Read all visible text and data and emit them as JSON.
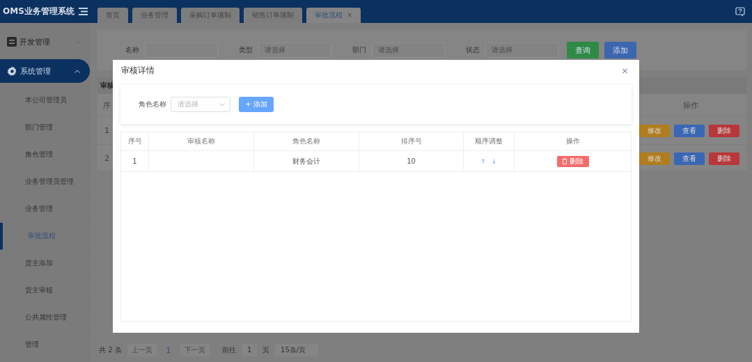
{
  "header": {
    "title": "OMS业务管理系统"
  },
  "tabs": [
    {
      "label": "首页",
      "selected": false
    },
    {
      "label": "业务管理",
      "selected": false
    },
    {
      "label": "采购订单填制",
      "selected": false
    },
    {
      "label": "销售订单填制",
      "selected": false
    },
    {
      "label": "审批流程",
      "selected": true,
      "close": "×"
    }
  ],
  "sidebar": {
    "groups": [
      {
        "label": "开发管理",
        "expanded": false,
        "selected": false
      },
      {
        "label": "系统管理",
        "expanded": true,
        "selected": true,
        "children": [
          {
            "label": "本公司管理员",
            "selected": false
          },
          {
            "label": "部门管理",
            "selected": false
          },
          {
            "label": "角色管理",
            "selected": false
          },
          {
            "label": "业务管理员管理",
            "selected": false
          },
          {
            "label": "业务管理",
            "selected": false
          },
          {
            "label": "审批流程",
            "selected": true
          },
          {
            "label": "货主添加",
            "selected": false
          },
          {
            "label": "货主审核",
            "selected": false
          },
          {
            "label": "公共属性管理",
            "selected": false
          },
          {
            "label": "管理",
            "selected": false
          }
        ]
      }
    ]
  },
  "filters": [
    {
      "label": "名称",
      "kind": "input"
    },
    {
      "label": "类型",
      "kind": "select",
      "placeholder": "请选择"
    },
    {
      "label": "部门",
      "kind": "select",
      "placeholder": "请选择"
    },
    {
      "label": "状态",
      "kind": "select",
      "placeholder": "请选择"
    }
  ],
  "filter_buttons": [
    {
      "label": "查询",
      "kind": "search"
    },
    {
      "label": "添加",
      "kind": "add"
    }
  ],
  "table": {
    "title": "审核",
    "columns": [
      "序",
      "操作"
    ],
    "rows": [
      {
        "index": "1",
        "actions": [
          {
            "label": "修改",
            "kind": "edit"
          },
          {
            "label": "查看",
            "kind": "view"
          },
          {
            "label": "删除",
            "kind": "delete"
          }
        ]
      },
      {
        "index": "2",
        "actions": [
          {
            "label": "修改",
            "kind": "edit"
          },
          {
            "label": "查看",
            "kind": "view"
          },
          {
            "label": "删除",
            "kind": "delete"
          }
        ]
      }
    ]
  },
  "pagination": {
    "total": "共 2 条",
    "prev": "上一页",
    "page": "1",
    "next": "下一页",
    "goto_label": "前往",
    "goto_value": "1",
    "page_unit": "页",
    "page_size": "15条/页"
  },
  "modal": {
    "title": "审核详情",
    "close": "×",
    "form": {
      "label": "角色名称",
      "placeholder": "请选择",
      "button": "添加",
      "button_icon": "+"
    },
    "columns": [
      "序号",
      "审核名称",
      "角色名称",
      "排序号",
      "顺序调整",
      "操作"
    ],
    "rows": [
      {
        "index": "1",
        "role": "财务会计",
        "order": "10",
        "up": "↑",
        "down": "↓",
        "action": "删除"
      }
    ]
  }
}
